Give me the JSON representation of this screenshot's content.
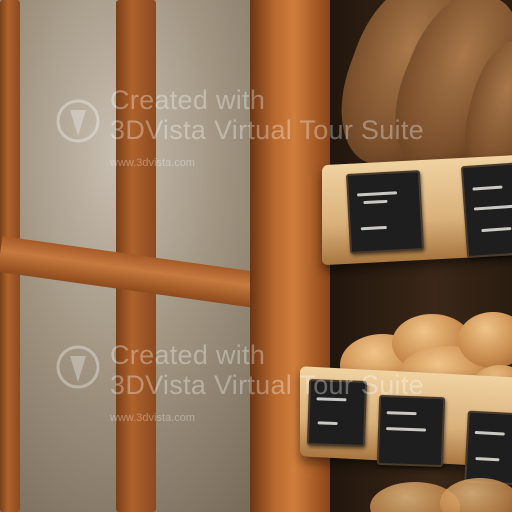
{
  "watermark": {
    "line1": "Created with",
    "line2": "3DVista Virtual Tour Suite",
    "url": "www.3dvista.com"
  }
}
